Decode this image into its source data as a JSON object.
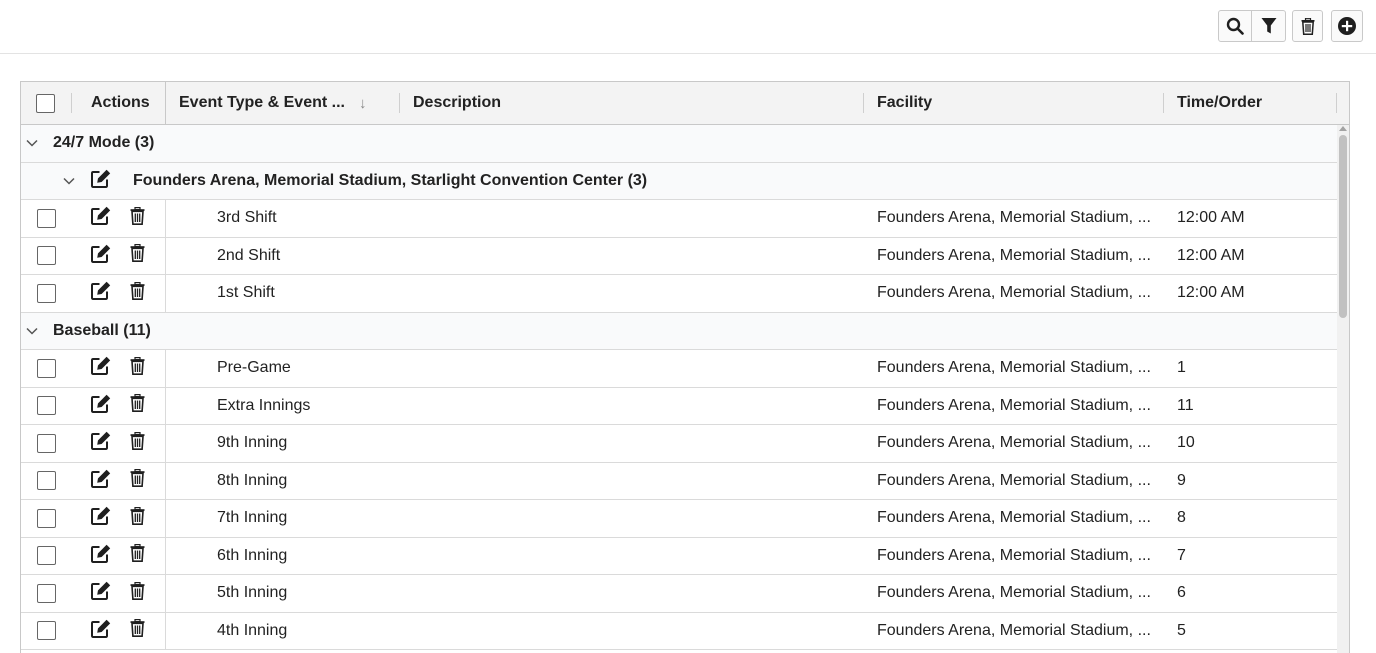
{
  "toolbar": {
    "search_icon": "search-icon",
    "filter_icon": "filter-icon",
    "delete_icon": "trash-icon",
    "add_icon": "plus-circle-icon"
  },
  "grid": {
    "columns": {
      "actions": "Actions",
      "event_type": "Event Type & Event ...",
      "sort_indicator": "↓",
      "description": "Description",
      "facility": "Facility",
      "time_order": "Time/Order"
    },
    "groups": [
      {
        "label": "24/7 Mode (3)",
        "subgroup": "Founders Arena, Memorial Stadium, Starlight Convention Center (3)",
        "rows": [
          {
            "event": "3rd Shift",
            "description": "",
            "facility": "Founders Arena, Memorial Stadium, ...",
            "time": "12:00 AM"
          },
          {
            "event": "2nd Shift",
            "description": "",
            "facility": "Founders Arena, Memorial Stadium, ...",
            "time": "12:00 AM"
          },
          {
            "event": "1st Shift",
            "description": "",
            "facility": "Founders Arena, Memorial Stadium, ...",
            "time": "12:00 AM"
          }
        ]
      },
      {
        "label": "Baseball (11)",
        "rows": [
          {
            "event": "Pre-Game",
            "description": "",
            "facility": "Founders Arena, Memorial Stadium, ...",
            "time": "1"
          },
          {
            "event": "Extra Innings",
            "description": "",
            "facility": "Founders Arena, Memorial Stadium, ...",
            "time": "11"
          },
          {
            "event": "9th Inning",
            "description": "",
            "facility": "Founders Arena, Memorial Stadium, ...",
            "time": "10"
          },
          {
            "event": "8th Inning",
            "description": "",
            "facility": "Founders Arena, Memorial Stadium, ...",
            "time": "9"
          },
          {
            "event": "7th Inning",
            "description": "",
            "facility": "Founders Arena, Memorial Stadium, ...",
            "time": "8"
          },
          {
            "event": "6th Inning",
            "description": "",
            "facility": "Founders Arena, Memorial Stadium, ...",
            "time": "7"
          },
          {
            "event": "5th Inning",
            "description": "",
            "facility": "Founders Arena, Memorial Stadium, ...",
            "time": "6"
          },
          {
            "event": "4th Inning",
            "description": "",
            "facility": "Founders Arena, Memorial Stadium, ...",
            "time": "5"
          }
        ]
      }
    ]
  }
}
